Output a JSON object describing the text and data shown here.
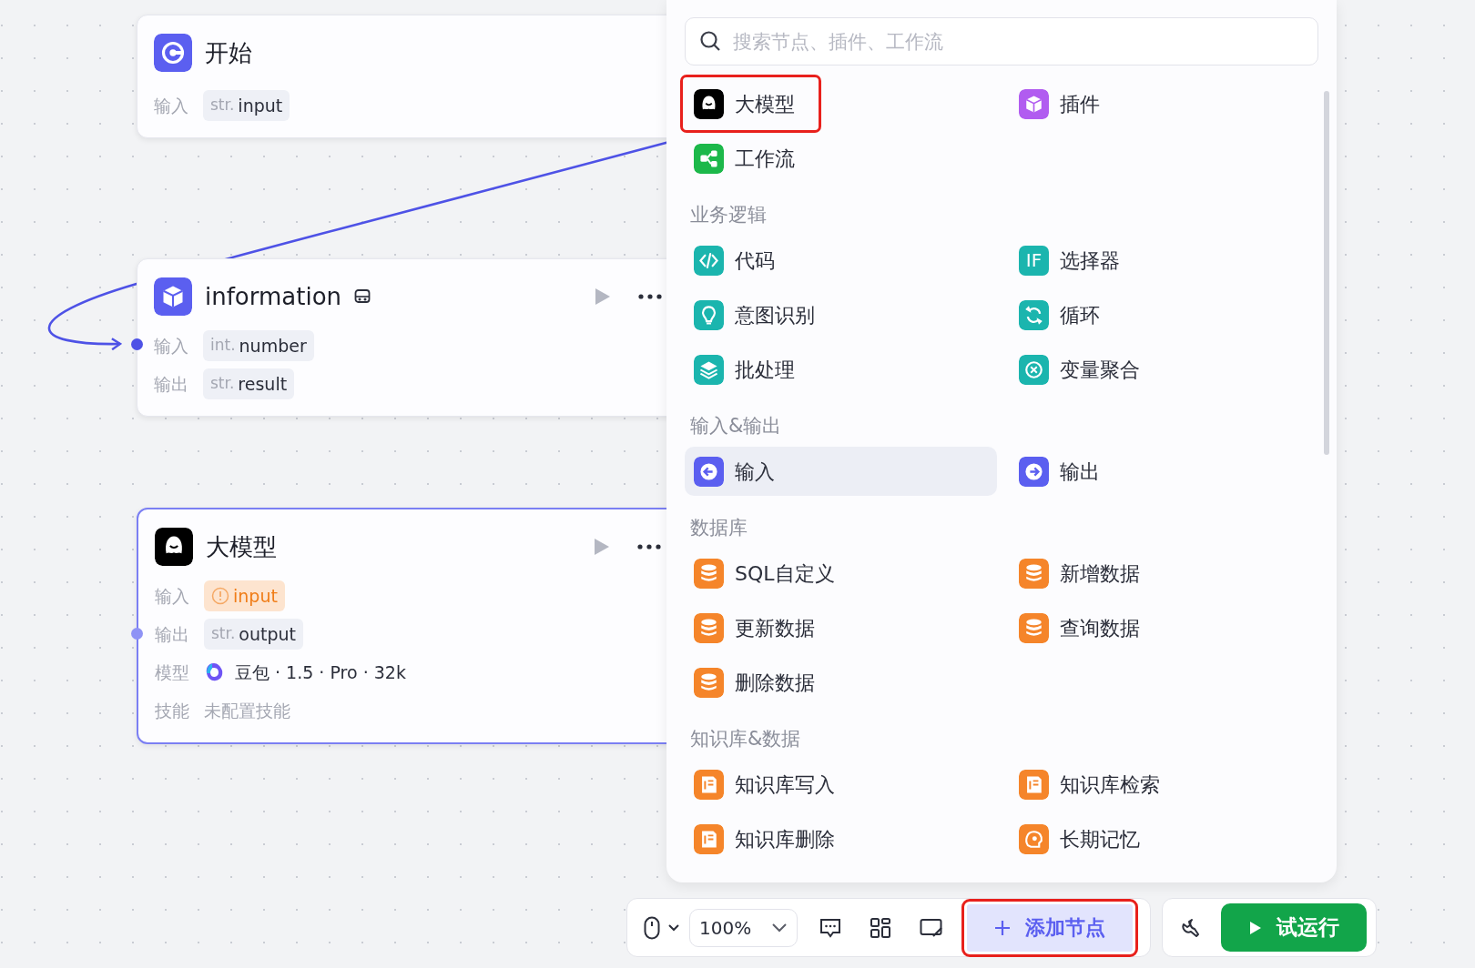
{
  "nodes": [
    {
      "kind": "start",
      "title": "开始",
      "selected": false,
      "port": false,
      "rows": [
        {
          "kind": "param",
          "label": "输入",
          "type": "str.",
          "value": "input",
          "warning": false
        }
      ]
    },
    {
      "kind": "plugin",
      "title": "information",
      "selected": false,
      "port": true,
      "rows": [
        {
          "kind": "param",
          "label": "输入",
          "type": "int.",
          "value": "number",
          "warning": false
        },
        {
          "kind": "param",
          "label": "输出",
          "type": "str.",
          "value": "result",
          "warning": false
        }
      ]
    },
    {
      "kind": "llm",
      "title": "大模型",
      "selected": true,
      "port": true,
      "rows": [
        {
          "kind": "param",
          "label": "输入",
          "value": "input",
          "warning": true
        },
        {
          "kind": "param",
          "label": "输出",
          "type": "str.",
          "value": "output",
          "warning": false
        },
        {
          "kind": "model",
          "label": "模型",
          "value": "豆包 · 1.5 · Pro · 32k"
        },
        {
          "kind": "text",
          "label": "技能",
          "value": "未配置技能"
        }
      ]
    }
  ],
  "panel": {
    "search": {
      "placeholder": "搜索节点、插件、工作流"
    },
    "sections": [
      {
        "items": [
          {
            "kind": "llm",
            "label": "大模型",
            "color": "#000000",
            "selected": false,
            "highlighted": true
          },
          {
            "kind": "plugin",
            "label": "插件",
            "color": "#b15cf0",
            "selected": false,
            "highlighted": false
          },
          {
            "kind": "workflow",
            "label": "工作流",
            "color": "#1cb84a",
            "selected": false,
            "highlighted": false
          }
        ]
      },
      {
        "title": "业务逻辑",
        "items": [
          {
            "kind": "code",
            "label": "代码",
            "color": "#1bb5ae",
            "selected": false,
            "highlighted": false
          },
          {
            "kind": "if",
            "label": "选择器",
            "icon_text": "IF",
            "color": "#1bb5ae",
            "selected": false,
            "highlighted": false
          },
          {
            "kind": "intent",
            "label": "意图识别",
            "color": "#1bb5ae",
            "selected": false,
            "highlighted": false
          },
          {
            "kind": "loop",
            "label": "循环",
            "color": "#1bb5ae",
            "selected": false,
            "highlighted": false
          },
          {
            "kind": "batch",
            "label": "批处理",
            "color": "#1bb5ae",
            "selected": false,
            "highlighted": false
          },
          {
            "kind": "aggregate",
            "label": "变量聚合",
            "color": "#1bb5ae",
            "selected": false,
            "highlighted": false
          }
        ]
      },
      {
        "title": "输入&输出",
        "items": [
          {
            "kind": "input",
            "label": "输入",
            "color": "#5b5ff0",
            "selected": true,
            "highlighted": false
          },
          {
            "kind": "output",
            "label": "输出",
            "color": "#5b5ff0",
            "selected": false,
            "highlighted": false
          }
        ]
      },
      {
        "title": "数据库",
        "items": [
          {
            "kind": "db",
            "label": "SQL自定义",
            "color": "#f5852a",
            "selected": false,
            "highlighted": false
          },
          {
            "kind": "db",
            "label": "新增数据",
            "color": "#f5852a",
            "selected": false,
            "highlighted": false
          },
          {
            "kind": "db",
            "label": "更新数据",
            "color": "#f5852a",
            "selected": false,
            "highlighted": false
          },
          {
            "kind": "db",
            "label": "查询数据",
            "color": "#f5852a",
            "selected": false,
            "highlighted": false
          },
          {
            "kind": "db",
            "label": "删除数据",
            "color": "#f5852a",
            "selected": false,
            "highlighted": false
          }
        ]
      },
      {
        "title": "知识库&数据",
        "items": [
          {
            "kind": "kb",
            "label": "知识库写入",
            "color": "#f5852a",
            "selected": false,
            "highlighted": false
          },
          {
            "kind": "kb",
            "label": "知识库检索",
            "color": "#f5852a",
            "selected": false,
            "highlighted": false
          },
          {
            "kind": "kb",
            "label": "知识库删除",
            "color": "#f5852a",
            "selected": false,
            "highlighted": false
          },
          {
            "kind": "memory",
            "label": "长期记忆",
            "color": "#f5852a",
            "selected": false,
            "highlighted": false
          }
        ]
      }
    ]
  },
  "toolbar": {
    "zoom": "100%",
    "add_button": {
      "label": "添加节点",
      "highlighted": true
    },
    "run_button": {
      "label": "试运行"
    }
  }
}
